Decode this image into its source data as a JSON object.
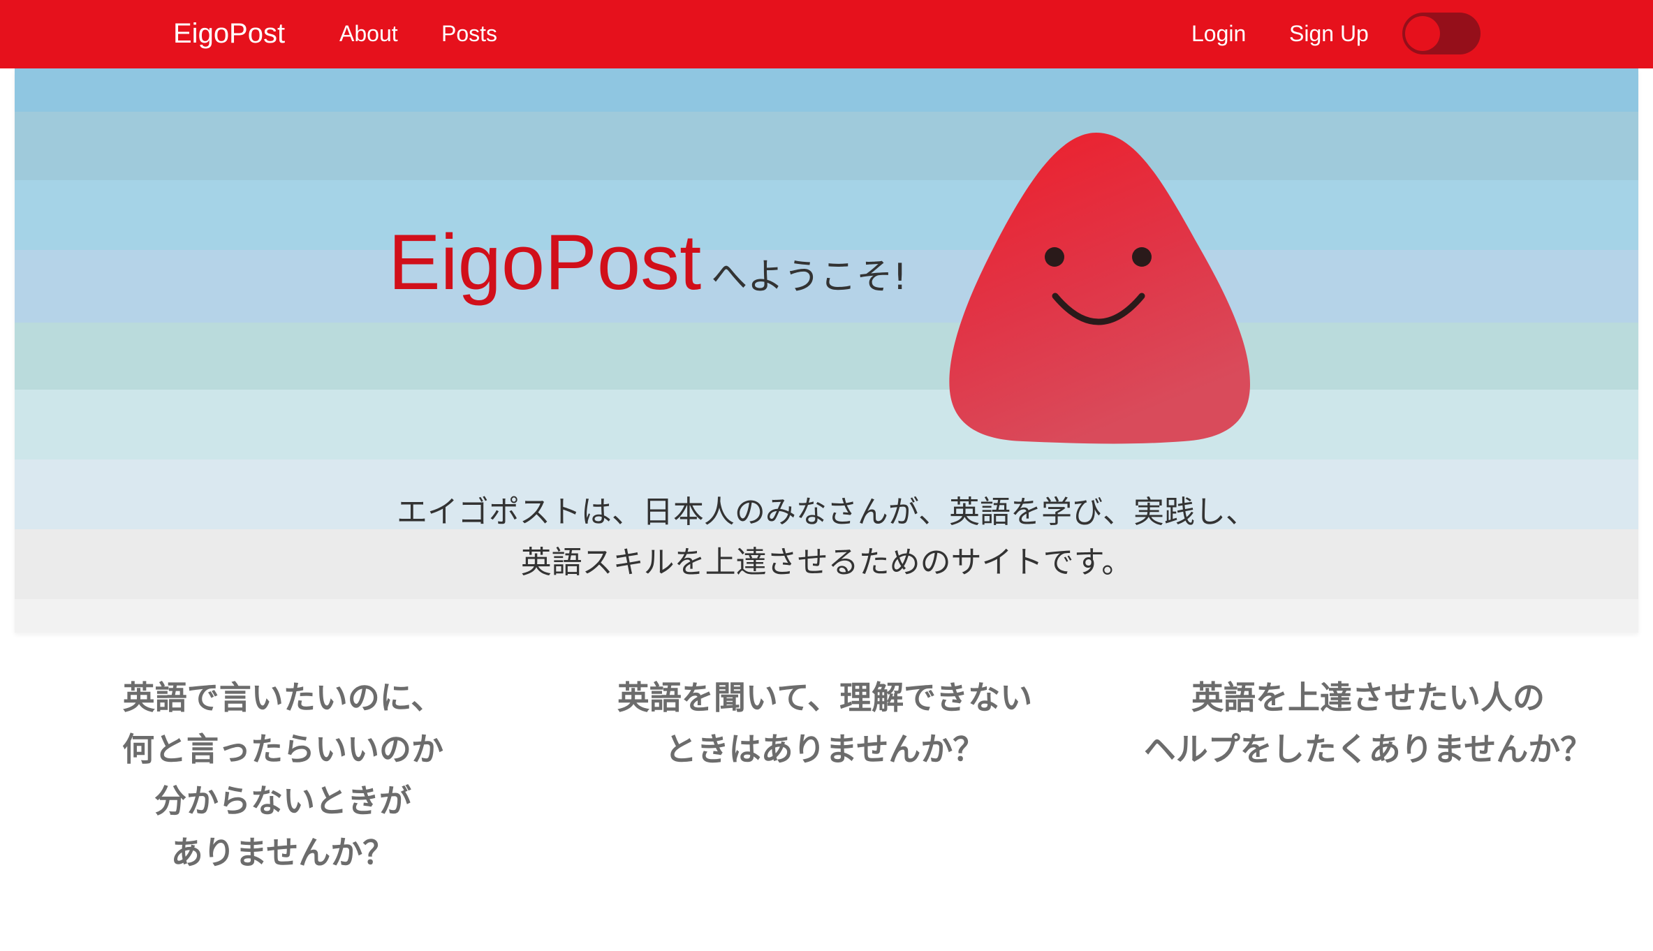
{
  "navbar": {
    "brand": "EigoPost",
    "links": [
      {
        "label": "About"
      },
      {
        "label": "Posts"
      }
    ],
    "login_label": "Login",
    "signup_label": "Sign Up",
    "toggle_on": true,
    "color": "#e6111c"
  },
  "hero": {
    "brand": "EigoPost",
    "welcome_suffix": "へようこそ!",
    "description_lines": [
      "エイゴポストは、日本人のみなさんが、英語を学び、実践し、",
      "英語スキルを上達させるためのサイトです。"
    ],
    "mascot_icon": "smiling-red-blob-icon"
  },
  "features": [
    {
      "lines": [
        "英語で言いたいのに、",
        "何と言ったらいいのか",
        "分からないときが",
        "ありませんか？"
      ]
    },
    {
      "lines": [
        "英語を聞いて、理解できない",
        "ときはありませんか？"
      ]
    },
    {
      "lines": [
        "英語を上達させたい人の",
        "ヘルプをしたくありませんか？"
      ]
    }
  ],
  "colors": {
    "brand_red": "#e6111c",
    "toggle_dark": "#950f1a",
    "feature_text": "#6c6c6c"
  }
}
